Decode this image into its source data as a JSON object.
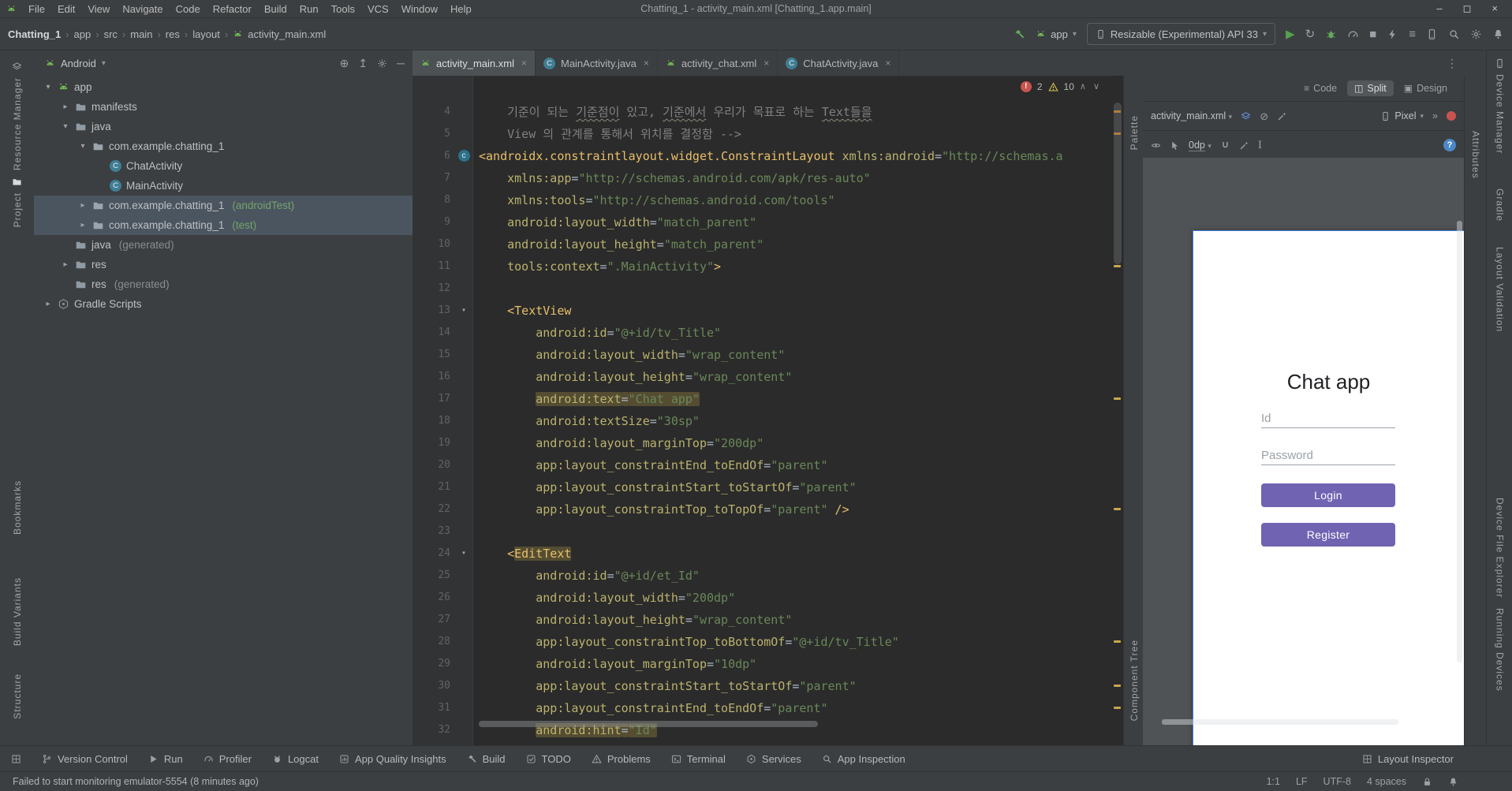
{
  "window": {
    "title": "Chatting_1 - activity_main.xml [Chatting_1.app.main]",
    "menus": [
      "File",
      "Edit",
      "View",
      "Navigate",
      "Code",
      "Refactor",
      "Build",
      "Run",
      "Tools",
      "VCS",
      "Window",
      "Help"
    ],
    "controls": {
      "minimize": "–",
      "maximize": "◻",
      "close": "×"
    }
  },
  "toolbar": {
    "breadcrumbs": [
      "Chatting_1",
      "app",
      "src",
      "main",
      "res",
      "layout",
      "activity_main.xml"
    ],
    "run_config_label": "app",
    "device_label": "Resizable (Experimental) API 33"
  },
  "tabs": [
    {
      "label": "activity_main.xml",
      "icon": "android",
      "active": true
    },
    {
      "label": "MainActivity.java",
      "icon": "class",
      "active": false
    },
    {
      "label": "activity_chat.xml",
      "icon": "android",
      "active": false
    },
    {
      "label": "ChatActivity.java",
      "icon": "class",
      "active": false
    }
  ],
  "project": {
    "selector": "Android",
    "tree": [
      {
        "label": "app",
        "depth": 0,
        "icon": "app",
        "exp": "open"
      },
      {
        "label": "manifests",
        "depth": 1,
        "icon": "folder",
        "exp": "closed"
      },
      {
        "label": "java",
        "depth": 1,
        "icon": "folder",
        "exp": "open"
      },
      {
        "label": "com.example.chatting_1",
        "depth": 2,
        "icon": "package",
        "exp": "open"
      },
      {
        "label": "ChatActivity",
        "depth": 3,
        "icon": "class"
      },
      {
        "label": "MainActivity",
        "depth": 3,
        "icon": "class"
      },
      {
        "label": "com.example.chatting_1",
        "suffix": "(androidTest)",
        "depth": 2,
        "icon": "package",
        "exp": "closed",
        "selected": true
      },
      {
        "label": "com.example.chatting_1",
        "suffix": "(test)",
        "depth": 2,
        "icon": "package",
        "exp": "closed",
        "selected": true
      },
      {
        "label": "java",
        "suffix": "(generated)",
        "depth": 1,
        "icon": "folder"
      },
      {
        "label": "res",
        "depth": 1,
        "icon": "folder",
        "exp": "closed"
      },
      {
        "label": "res",
        "suffix": "(generated)",
        "depth": 1,
        "icon": "folder"
      },
      {
        "label": "Gradle Scripts",
        "depth": 0,
        "icon": "gradle",
        "exp": "closed"
      }
    ]
  },
  "editor": {
    "inspection": {
      "errors": "2",
      "warnings": "10"
    },
    "stripe": {
      "warn_lines": [
        11,
        17,
        22,
        28,
        30,
        31
      ],
      "info_lines": [
        4,
        5
      ]
    },
    "lines": [
      {
        "n": 4,
        "t": [
          [
            "    ",
            "pl"
          ],
          [
            "기준이 되는 ",
            "cm"
          ],
          [
            "기준점이",
            "cm cmu"
          ],
          [
            " 있고, ",
            "cm"
          ],
          [
            "기준에서",
            "cm cmu"
          ],
          [
            " 우리가 목표로 하는 ",
            "cm"
          ],
          [
            "Text들을",
            "cm cmu"
          ]
        ]
      },
      {
        "n": 5,
        "t": [
          [
            "    ",
            "pl"
          ],
          [
            "View 의 관계를 통해서 위치를 결정함 -->",
            "cm"
          ]
        ]
      },
      {
        "n": 6,
        "g": "c",
        "t": [
          [
            "<androidx.constraintlayout.widget.ConstraintLayout",
            "tag"
          ],
          [
            " ",
            "pl"
          ],
          [
            "xmlns:android",
            "attr"
          ],
          [
            "=",
            "eq"
          ],
          [
            "\"http://schemas.a",
            "val"
          ]
        ]
      },
      {
        "n": 7,
        "t": [
          [
            "    ",
            "pl"
          ],
          [
            "xmlns:app",
            "attr"
          ],
          [
            "=",
            "eq"
          ],
          [
            "\"http://schemas.android.com/apk/res-auto\"",
            "val"
          ]
        ]
      },
      {
        "n": 8,
        "t": [
          [
            "    ",
            "pl"
          ],
          [
            "xmlns:tools",
            "attr"
          ],
          [
            "=",
            "eq"
          ],
          [
            "\"http://schemas.android.com/tools\"",
            "val"
          ]
        ]
      },
      {
        "n": 9,
        "t": [
          [
            "    ",
            "pl"
          ],
          [
            "android:layout_width",
            "attr"
          ],
          [
            "=",
            "eq"
          ],
          [
            "\"match_parent\"",
            "val"
          ]
        ]
      },
      {
        "n": 10,
        "t": [
          [
            "    ",
            "pl"
          ],
          [
            "android:layout_height",
            "attr"
          ],
          [
            "=",
            "eq"
          ],
          [
            "\"match_parent\"",
            "val"
          ]
        ]
      },
      {
        "n": 11,
        "t": [
          [
            "    ",
            "pl"
          ],
          [
            "tools:context",
            "attr"
          ],
          [
            "=",
            "eq"
          ],
          [
            "\".MainActivity\"",
            "val"
          ],
          [
            ">",
            "tag"
          ]
        ]
      },
      {
        "n": 12,
        "t": []
      },
      {
        "n": 13,
        "fold": true,
        "t": [
          [
            "    ",
            "pl"
          ],
          [
            "<TextView",
            "tag"
          ]
        ]
      },
      {
        "n": 14,
        "t": [
          [
            "        ",
            "pl"
          ],
          [
            "android:id",
            "attr"
          ],
          [
            "=",
            "eq"
          ],
          [
            "\"@+id/tv_Title\"",
            "val"
          ]
        ]
      },
      {
        "n": 15,
        "t": [
          [
            "        ",
            "pl"
          ],
          [
            "android:layout_width",
            "attr"
          ],
          [
            "=",
            "eq"
          ],
          [
            "\"wrap_content\"",
            "val"
          ]
        ]
      },
      {
        "n": 16,
        "t": [
          [
            "        ",
            "pl"
          ],
          [
            "android:layout_height",
            "attr"
          ],
          [
            "=",
            "eq"
          ],
          [
            "\"wrap_content\"",
            "val"
          ]
        ]
      },
      {
        "n": 17,
        "t": [
          [
            "        ",
            "pl"
          ],
          [
            "android:text",
            "attr hl"
          ],
          [
            "=",
            "eq hl"
          ],
          [
            "\"Chat app\"",
            "val hl"
          ]
        ]
      },
      {
        "n": 18,
        "t": [
          [
            "        ",
            "pl"
          ],
          [
            "android:textSize",
            "attr"
          ],
          [
            "=",
            "eq"
          ],
          [
            "\"30sp\"",
            "val"
          ]
        ]
      },
      {
        "n": 19,
        "t": [
          [
            "        ",
            "pl"
          ],
          [
            "android:layout_marginTop",
            "attr"
          ],
          [
            "=",
            "eq"
          ],
          [
            "\"200dp\"",
            "val"
          ]
        ]
      },
      {
        "n": 20,
        "t": [
          [
            "        ",
            "pl"
          ],
          [
            "app:layout_constraintEnd_toEndOf",
            "attr"
          ],
          [
            "=",
            "eq"
          ],
          [
            "\"parent\"",
            "val"
          ]
        ]
      },
      {
        "n": 21,
        "t": [
          [
            "        ",
            "pl"
          ],
          [
            "app:layout_constraintStart_toStartOf",
            "attr"
          ],
          [
            "=",
            "eq"
          ],
          [
            "\"parent\"",
            "val"
          ]
        ]
      },
      {
        "n": 22,
        "t": [
          [
            "        ",
            "pl"
          ],
          [
            "app:layout_constraintTop_toTopOf",
            "attr"
          ],
          [
            "=",
            "eq"
          ],
          [
            "\"parent\"",
            "val"
          ],
          [
            " ",
            "pl"
          ],
          [
            "/>",
            "tag"
          ]
        ]
      },
      {
        "n": 23,
        "t": []
      },
      {
        "n": 24,
        "fold": true,
        "t": [
          [
            "    ",
            "pl"
          ],
          [
            "<",
            "tag"
          ],
          [
            "EditText",
            "tag hl"
          ]
        ]
      },
      {
        "n": 25,
        "t": [
          [
            "        ",
            "pl"
          ],
          [
            "android:id",
            "attr"
          ],
          [
            "=",
            "eq"
          ],
          [
            "\"@+id/et_Id\"",
            "val"
          ]
        ]
      },
      {
        "n": 26,
        "t": [
          [
            "        ",
            "pl"
          ],
          [
            "android:layout_width",
            "attr"
          ],
          [
            "=",
            "eq"
          ],
          [
            "\"200dp\"",
            "val"
          ]
        ]
      },
      {
        "n": 27,
        "t": [
          [
            "        ",
            "pl"
          ],
          [
            "android:layout_height",
            "attr"
          ],
          [
            "=",
            "eq"
          ],
          [
            "\"wrap_content\"",
            "val"
          ]
        ]
      },
      {
        "n": 28,
        "t": [
          [
            "        ",
            "pl"
          ],
          [
            "app:layout_constraintTop_toBottomOf",
            "attr"
          ],
          [
            "=",
            "eq"
          ],
          [
            "\"@+id/tv_Title\"",
            "val"
          ]
        ]
      },
      {
        "n": 29,
        "t": [
          [
            "        ",
            "pl"
          ],
          [
            "android:layout_marginTop",
            "attr"
          ],
          [
            "=",
            "eq"
          ],
          [
            "\"10dp\"",
            "val"
          ]
        ]
      },
      {
        "n": 30,
        "t": [
          [
            "        ",
            "pl"
          ],
          [
            "app:layout_constraintStart_toStartOf",
            "attr"
          ],
          [
            "=",
            "eq"
          ],
          [
            "\"parent\"",
            "val"
          ]
        ]
      },
      {
        "n": 31,
        "t": [
          [
            "        ",
            "pl"
          ],
          [
            "app:layout_constraintEnd_toEndOf",
            "attr"
          ],
          [
            "=",
            "eq"
          ],
          [
            "\"parent\"",
            "val"
          ]
        ]
      },
      {
        "n": 32,
        "t": [
          [
            "        ",
            "pl"
          ],
          [
            "android:hint",
            "attr hl"
          ],
          [
            "=",
            "eq hl"
          ],
          [
            "\"Id\"",
            "val hl"
          ]
        ]
      }
    ]
  },
  "design": {
    "modes": [
      {
        "label": "Code",
        "active": false
      },
      {
        "label": "Split",
        "active": true
      },
      {
        "label": "Design",
        "active": false
      }
    ],
    "file_selector": "activity_main.xml",
    "device_selector": "Pixel",
    "default_margin": "0dp",
    "overflow_label": "»",
    "help_label": "?",
    "preview": {
      "title": "Chat app",
      "id_hint": "Id",
      "password_hint": "Password",
      "login": "Login",
      "register": "Register"
    }
  },
  "strips": {
    "left": [
      {
        "label": "Resource Manager",
        "icon": "layers"
      },
      {
        "label": "Project",
        "icon": "folder",
        "active": true
      },
      {
        "label": "Bookmarks"
      },
      {
        "label": "Build Variants"
      },
      {
        "label": "Structure"
      }
    ],
    "right": [
      {
        "label": "Device Manager",
        "icon": "phone"
      },
      {
        "label": "Gradle"
      },
      {
        "label": "Layout Validation"
      },
      {
        "label": "Device File Explorer"
      },
      {
        "label": "Running Devices"
      }
    ],
    "palette": "Palette",
    "component_tree": "Component Tree",
    "attributes": "Attributes"
  },
  "bottom_tools": {
    "left": [
      {
        "label": "Version Control",
        "icon": "branch"
      },
      {
        "label": "Run",
        "icon": "play"
      },
      {
        "label": "Profiler",
        "icon": "gauge"
      },
      {
        "label": "Logcat",
        "icon": "cat"
      },
      {
        "label": "App Quality Insights",
        "icon": "chart"
      },
      {
        "label": "Build",
        "icon": "hammer"
      },
      {
        "label": "TODO",
        "icon": "check"
      },
      {
        "label": "Problems",
        "icon": "warn"
      },
      {
        "label": "Terminal",
        "icon": "terminal"
      },
      {
        "label": "Services",
        "icon": "hex"
      },
      {
        "label": "App Inspection",
        "icon": "magnify"
      }
    ],
    "right": [
      {
        "label": "Layout Inspector",
        "icon": "grid"
      }
    ]
  },
  "status_bar": {
    "message": "Failed to start monitoring emulator-5554 (8 minutes ago)",
    "position": "1:1",
    "line_separator": "LF",
    "encoding": "UTF-8",
    "indent": "4 spaces"
  }
}
